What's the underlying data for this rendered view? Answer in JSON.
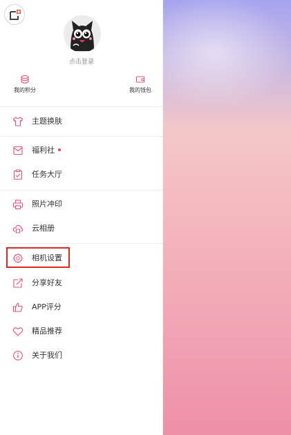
{
  "accent_color": "#e8506f",
  "header": {
    "login_label": "点击登录",
    "corner_icon": "add-photo-icon"
  },
  "quick_links": {
    "points": {
      "label": "我的积分",
      "icon": "coins-icon"
    },
    "wallet": {
      "label": "我的钱包",
      "icon": "wallet-icon"
    }
  },
  "menu": {
    "theme": {
      "label": "主题换肤",
      "icon": "shirt-icon"
    },
    "welfare": {
      "label": "福利社",
      "icon": "envelope-icon",
      "badge": true
    },
    "tasks": {
      "label": "任务大厅",
      "icon": "clipboard-check-icon"
    },
    "print": {
      "label": "照片冲印",
      "icon": "printer-icon"
    },
    "cloud": {
      "label": "云相册",
      "icon": "cloud-album-icon"
    },
    "camera_settings": {
      "label": "相机设置",
      "icon": "gear-icon",
      "highlighted": true
    },
    "share": {
      "label": "分享好友",
      "icon": "share-icon"
    },
    "rate": {
      "label": "APP评分",
      "icon": "thumbs-up-icon"
    },
    "featured": {
      "label": "精品推荐",
      "icon": "heart-icon"
    },
    "about": {
      "label": "关于我们",
      "icon": "info-icon"
    }
  }
}
